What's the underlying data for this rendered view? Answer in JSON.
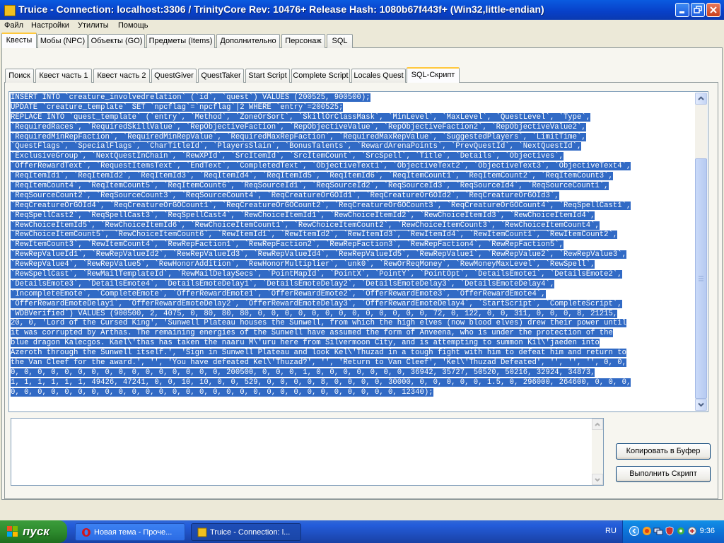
{
  "window": {
    "title": "Truice - Connection: localhost:3306 / TrinityCore Rev: 10476+ Release Hash: 1080b67f443f+ (Win32,little-endian)"
  },
  "menu": [
    "Файл",
    "Настройки",
    "Утилиты",
    "Помощь"
  ],
  "top_tabs": [
    "Квесты",
    "Мобы (NPC)",
    "Объекты (GO)",
    "Предметы (Items)",
    "Дополнительно",
    "Персонаж",
    "SQL"
  ],
  "top_tab_active": "Квесты",
  "sub_tabs": [
    "Поиск",
    "Квест часть 1",
    "Квест часть 2",
    "QuestGiver",
    "QuestTaker",
    "Start Script",
    "Complete Script",
    "Locales Quest",
    "SQL-Скрипт"
  ],
  "sub_tab_active": "SQL-Скрипт",
  "sql_lines": [
    "INSERT INTO `creature_involvedrelation` (`id`, `quest`) VALUES (200525, 900500);",
    "UPDATE `creature_template` SET `npcflag`=`npcflag`|2 WHERE `entry`=200525;",
    "REPLACE INTO `quest_template` (`entry`, `Method`, `ZoneOrSort`, `SkillOrClassMask`, `MinLevel`, `MaxLevel`, `QuestLevel`, `Type`,",
    "`RequiredRaces`, `RequiredSkillValue`, `RepObjectiveFaction`, `RepObjectiveValue`, `RepObjectiveFaction2`, `RepObjectiveValue2`,",
    "`RequiredMinRepFaction`, `RequiredMinRepValue`, `RequiredMaxRepFaction`, `RequiredMaxRepValue`, `SuggestedPlayers`, `LimitTime`,",
    "`QuestFlags`, `SpecialFlags`, `CharTitleId`, `PlayersSlain`, `BonusTalents`, `RewardArenaPoints`, `PrevQuestId`, `NextQuestId`,",
    "`ExclusiveGroup`, `NextQuestInChain`, `RewXPId`, `SrcItemId`, `SrcItemCount`, `SrcSpell`, `Title`, `Details`, `Objectives`,",
    "`OfferRewardText`, `RequestItemsText`, `EndText`, `CompletedText`, `ObjectiveText1`, `ObjectiveText2`, `ObjectiveText3`, `ObjectiveText4`,",
    "`ReqItemId1`, `ReqItemId2`, `ReqItemId3`, `ReqItemId4`, `ReqItemId5`, `ReqItemId6`, `ReqItemCount1`, `ReqItemCount2`, `ReqItemCount3`,",
    "`ReqItemCount4`, `ReqItemCount5`, `ReqItemCount6`, `ReqSourceId1`, `ReqSourceId2`, `ReqSourceId3`, `ReqSourceId4`, `ReqSourceCount1`,",
    "`ReqSourceCount2`, `ReqSourceCount3`, `ReqSourceCount4`, `ReqCreatureOrGOId1`, `ReqCreatureOrGOId2`, `ReqCreatureOrGOId3`,",
    "`ReqCreatureOrGOId4`, `ReqCreatureOrGOCount1`, `ReqCreatureOrGOCount2`, `ReqCreatureOrGOCount3`, `ReqCreatureOrGOCount4`, `ReqSpellCast1`,",
    "`ReqSpellCast2`, `ReqSpellCast3`, `ReqSpellCast4`, `RewChoiceItemId1`, `RewChoiceItemId2`, `RewChoiceItemId3`, `RewChoiceItemId4`,",
    "`RewChoiceItemId5`, `RewChoiceItemId6`, `RewChoiceItemCount1`, `RewChoiceItemCount2`, `RewChoiceItemCount3`, `RewChoiceItemCount4`,",
    "`RewChoiceItemCount5`, `RewChoiceItemCount6`, `RewItemId1`, `RewItemId2`, `RewItemId3`, `RewItemId4`, `RewItemCount1`, `RewItemCount2`,",
    "`RewItemCount3`, `RewItemCount4`, `RewRepFaction1`, `RewRepFaction2`, `RewRepFaction3`, `RewRepFaction4`, `RewRepFaction5`,",
    "`RewRepValueId1`, `RewRepValueId2`, `RewRepValueId3`, `RewRepValueId4`, `RewRepValueId5`, `RewRepValue1`, `RewRepValue2`, `RewRepValue3`,",
    "`RewRepValue4`, `RewRepValue5`, `RewHonorAddition`, `RewHonorMultiplier`, `unk0`, `RewOrReqMoney`, `RewMoneyMaxLevel`, `RewSpell`,",
    "`RewSpellCast`, `RewMailTemplateId`, `RewMailDelaySecs`, `PointMapId`, `PointX`, `PointY`, `PointOpt`, `DetailsEmote1`, `DetailsEmote2`,",
    "`DetailsEmote3`, `DetailsEmote4`, `DetailsEmoteDelay1`, `DetailsEmoteDelay2`, `DetailsEmoteDelay3`, `DetailsEmoteDelay4`,",
    "`IncompleteEmote`, `CompleteEmote`, `OfferRewardEmote1`, `OfferRewardEmote2`, `OfferRewardEmote3`, `OfferRewardEmote4`,",
    "`OfferRewardEmoteDelay1`, `OfferRewardEmoteDelay2`, `OfferRewardEmoteDelay3`, `OfferRewardEmoteDelay4`, `StartScript`, `CompleteScript`,",
    "`WDBVerified`) VALUES (900500, 2, 4075, 0, 80, 80, 80, 0, 0, 0, 0, 0, 0, 0, 0, 0, 0, 0, 0, 0, 72, 0, 122, 0, 0, 311, 0, 0, 0, 8, 21215,",
    "20, 0, 'Lord of the Cursed King', 'Sunwell Plateau houses the Sunwell, from which the high elves (now blood elves) drew their power until",
    "it was corrupted by Arthas. The remaining energies of the Sunwell have assumed the form of Anveena, who is under the protection of the",
    "blue dragon Kalecgos. Kael\\'thas has taken the naaru M\\'uru here from Silvermoon City, and is attempting to summon Kil\\'jaeden into",
    "Azeroth through the Sunwell itself.', 'Sign in Sunwell Plateau and look Kel\\'Thuzad in a tough fight with him to defeat him and return to",
    "the Van Cleef for the award.', '', 'You have defeated Kel\\'Thuzad?', '', 'Return to Van Cleef', 'Kel\\'Thuzad Defeated', '', '', '', 0, 0,",
    "0, 0, 0, 0, 0, 0, 0, 0, 0, 0, 0, 0, 0, 0, 0, 0, 200500, 0, 0, 0, 1, 0, 0, 0, 0, 0, 0, 0, 36942, 35727, 50520, 50216, 32924, 34873,",
    "1, 1, 1, 1, 1, 1, 49426, 47241, 0, 0, 10, 10, 0, 0, 529, 0, 0, 0, 0, 8, 0, 0, 0, 0, 30000, 0, 0, 0, 0, 0, 1.5, 0, 296000, 264600, 0, 0, 0,",
    "0, 0, 0, 0, 0, 0, 0, 0, 0, 0, 0, 0, 0, 0, 0, 0, 0, 0, 0, 0, 0, 0, 0, 0, 0, 0, 0, 0, 0, 12340);"
  ],
  "buttons": {
    "copy": "Копировать в Буфер",
    "run": "Выполнить Скрипт"
  },
  "taskbar": {
    "start": "пуск",
    "tasks": [
      "Новая тема - Проче...",
      "Truice - Connection: l..."
    ],
    "lang": "RU",
    "clock": "9:36"
  },
  "colors": {
    "selection": "#316AC5",
    "titlebar": "#0A5BE0",
    "taskbar": "#245DDB"
  }
}
